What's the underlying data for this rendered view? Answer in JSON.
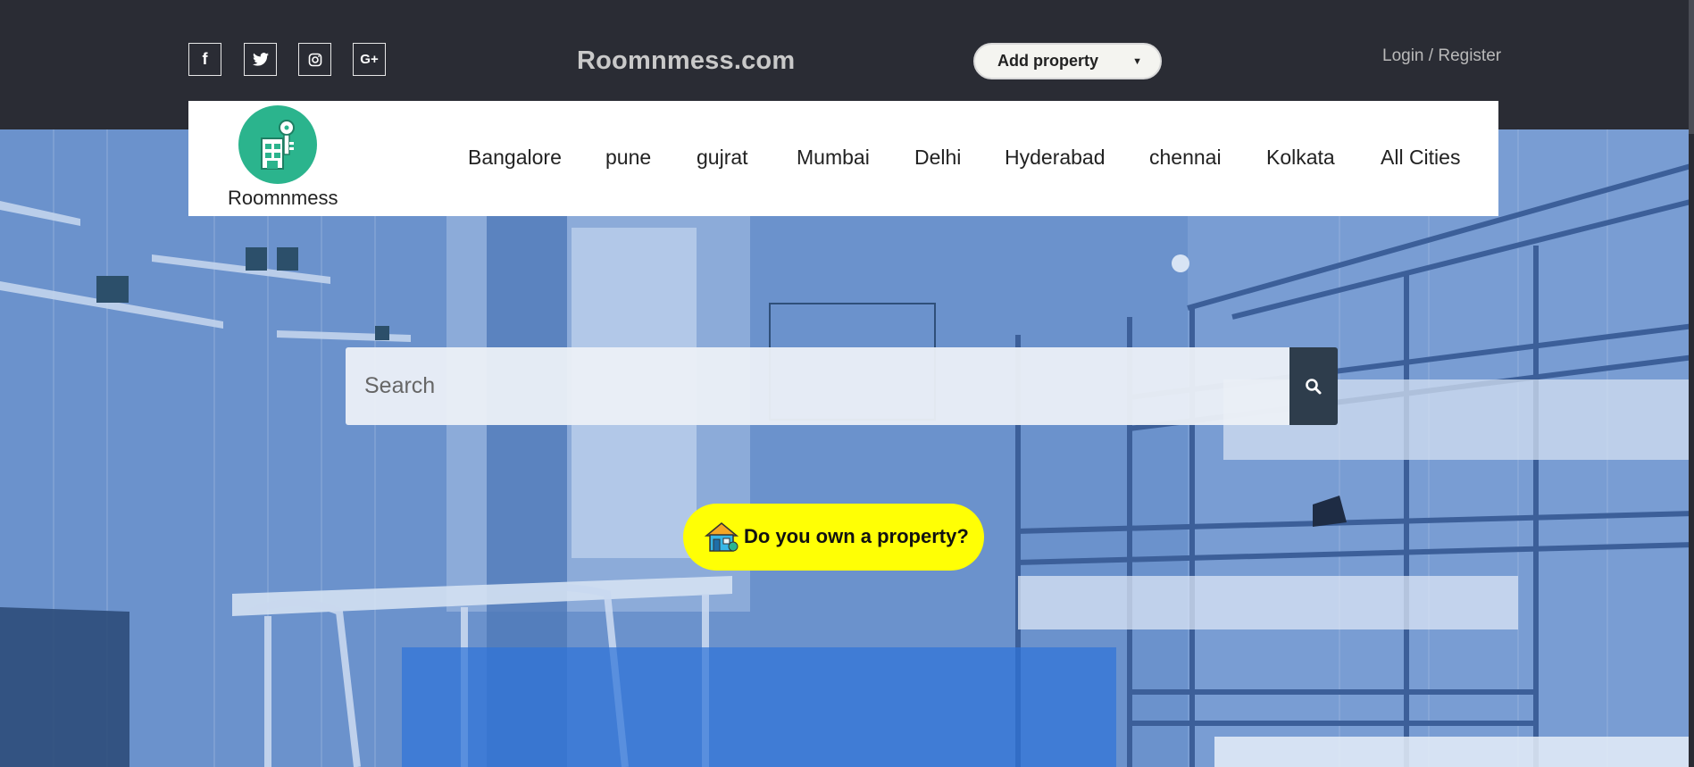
{
  "topbar": {
    "social": [
      {
        "icon": "facebook-icon",
        "glyph": "f"
      },
      {
        "icon": "twitter-icon",
        "glyph": ""
      },
      {
        "icon": "instagram-icon",
        "glyph": ""
      },
      {
        "icon": "google-plus-icon",
        "glyph": "G+"
      }
    ],
    "brand": "Roomnmess.com",
    "add_property": {
      "label": "Add property"
    },
    "login": "Login",
    "separator": " / ",
    "register": "Register"
  },
  "nav": {
    "logo_text": "Roomnmess",
    "items": [
      "Bangalore",
      "pune",
      "gujrat",
      "Mumbai",
      "Delhi",
      "Hyderabad",
      "chennai",
      "Kolkata",
      "All Cities"
    ]
  },
  "search": {
    "placeholder": "Search"
  },
  "cta": {
    "label": "Do you own a property?"
  },
  "colors": {
    "topbar": "#2a2c34",
    "hero_overlay": "#5f86c2",
    "logo_green": "#2bb48d",
    "cta_yellow": "#ffff05",
    "search_button": "#2e3d4c"
  }
}
